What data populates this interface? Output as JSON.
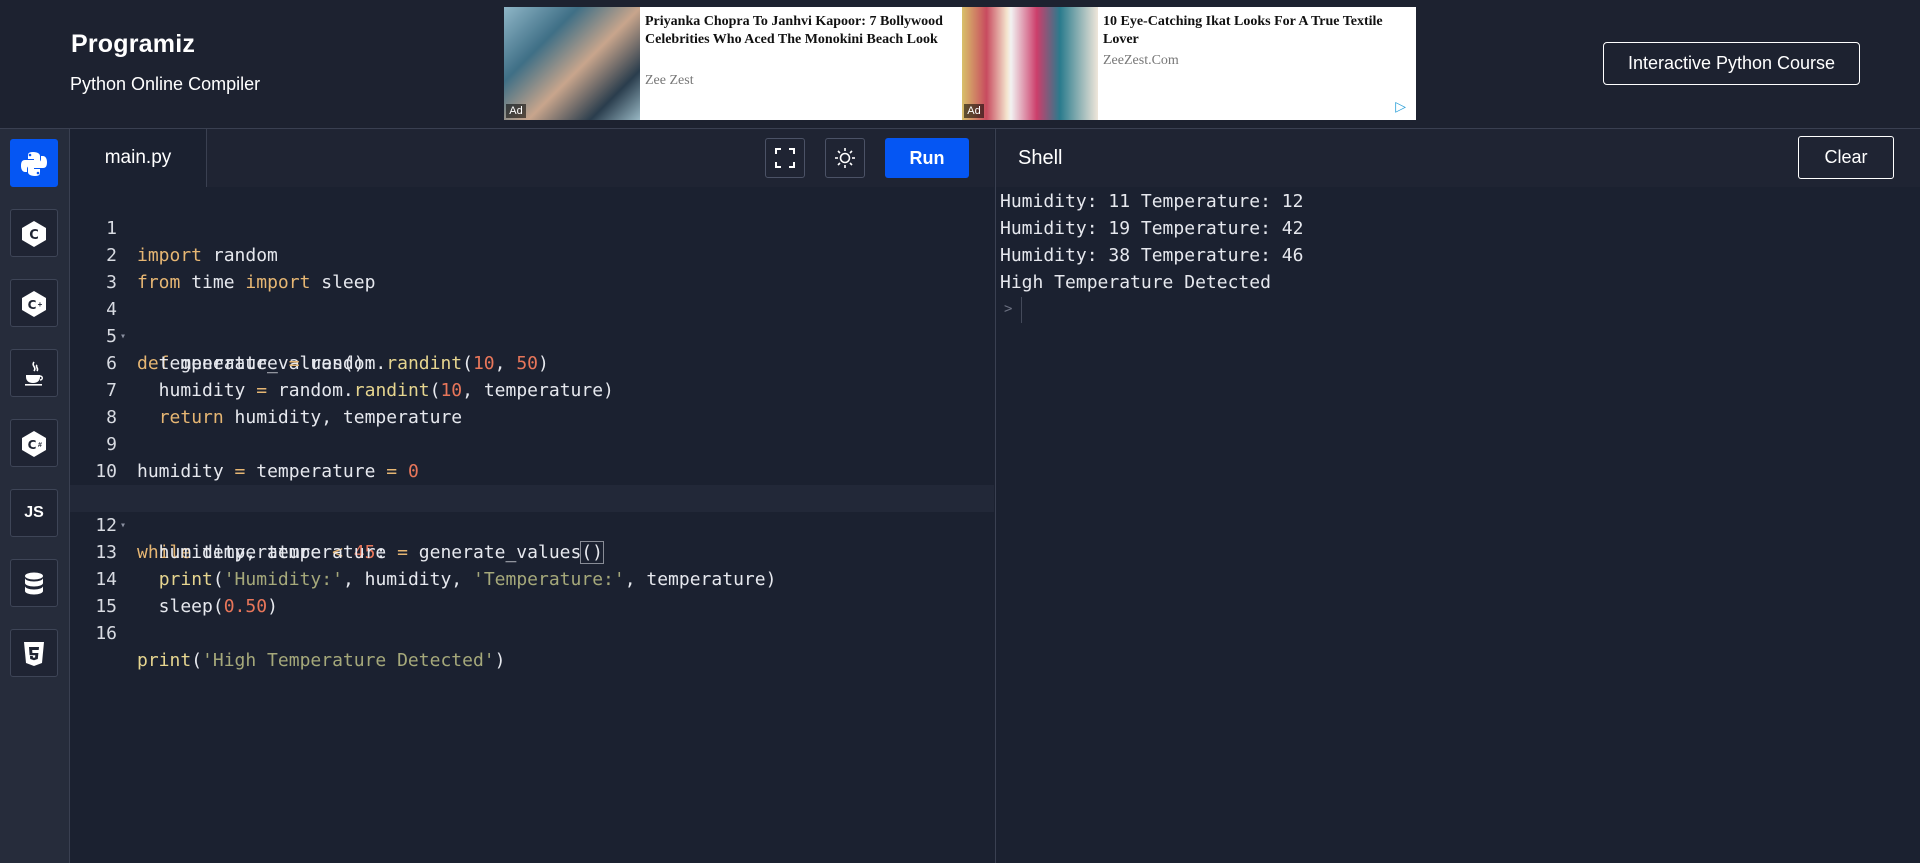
{
  "header": {
    "logo": "Programiz",
    "subtitle": "Python Online Compiler",
    "course_button": "Interactive Python Course"
  },
  "ad": {
    "badge": "Ad",
    "items": [
      {
        "title": "Priyanka Chopra To Janhvi Kapoor: 7 Bollywood Celebrities Who Aced The Monokini Beach Look",
        "source": "Zee Zest"
      },
      {
        "title": "10 Eye-Catching Ikat Looks For A True Textile Lover",
        "source": "ZeeZest.Com"
      }
    ]
  },
  "sidebar": {
    "languages": [
      {
        "name": "python-icon",
        "label": "",
        "active": true
      },
      {
        "name": "c-icon",
        "label": "",
        "active": false
      },
      {
        "name": "cpp-icon",
        "label": "",
        "active": false
      },
      {
        "name": "java-icon",
        "label": "",
        "active": false
      },
      {
        "name": "csharp-icon",
        "label": "",
        "active": false
      },
      {
        "name": "js-icon",
        "label": "JS",
        "active": false
      },
      {
        "name": "sql-icon",
        "label": "",
        "active": false
      },
      {
        "name": "html5-icon",
        "label": "",
        "active": false
      }
    ]
  },
  "editor": {
    "tab": "main.py",
    "run_label": "Run",
    "line_numbers": [
      "1",
      "2",
      "3",
      "4",
      "5",
      "6",
      "7",
      "8",
      "9",
      "10",
      "11",
      "12",
      "13",
      "14",
      "15",
      "16"
    ]
  },
  "shell": {
    "title": "Shell",
    "clear_label": "Clear",
    "output": [
      "Humidity: 11 Temperature: 12",
      "Humidity: 19 Temperature: 42",
      "Humidity: 38 Temperature: 46",
      "High Temperature Detected"
    ],
    "prompt": ">"
  },
  "code": {
    "l1": {
      "a": "import",
      "b": " random"
    },
    "l2": {
      "a": "from",
      "b": " time ",
      "c": "import",
      "d": " sleep"
    },
    "l4": {
      "a": "def",
      "b": " generate_values():"
    },
    "l5": {
      "a": "  temperature ",
      "b": "=",
      "c": " random.",
      "d": "randint",
      "e": "(",
      "f": "10",
      "g": ", ",
      "h": "50",
      "i": ")"
    },
    "l6": {
      "a": "  humidity ",
      "b": "=",
      "c": " random.",
      "d": "randint",
      "e": "(",
      "f": "10",
      "g": ", temperature)"
    },
    "l7": {
      "a": "  ",
      "b": "return",
      "c": " humidity, temperature"
    },
    "l9": {
      "a": "humidity ",
      "b": "=",
      "c": " temperature ",
      "d": "=",
      "e": " ",
      "f": "0"
    },
    "l11": {
      "a": "while",
      "b": " temperature ",
      "c": "<",
      "d": " ",
      "e": "45",
      "f": ":"
    },
    "l12": {
      "a": "  humidity, temperature ",
      "b": "=",
      "c": " generate_values",
      "d": "()"
    },
    "l13": {
      "a": "  ",
      "b": "print",
      "c": "(",
      "d": "'Humidity:'",
      "e": ", humidity, ",
      "f": "'Temperature:'",
      "g": ", temperature)"
    },
    "l14": {
      "a": "  sleep(",
      "b": "0.50",
      "c": ")"
    },
    "l16": {
      "a": "print",
      "b": "(",
      "c": "'High Temperature Detected'",
      "d": ")"
    }
  },
  "colors": {
    "accent": "#0556f3",
    "background": "#1b2130",
    "keyword": "#e6b673",
    "number": "#e8765a",
    "string": "#a5a87a"
  }
}
